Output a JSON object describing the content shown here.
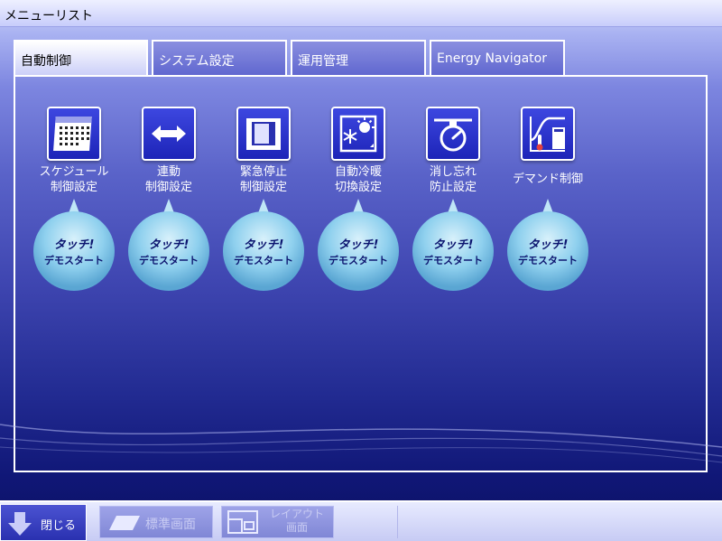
{
  "window": {
    "title": "メニューリスト"
  },
  "tabs": [
    {
      "label": "自動制御",
      "active": true
    },
    {
      "label": "システム設定",
      "active": false
    },
    {
      "label": "運用管理",
      "active": false
    },
    {
      "label": "Energy Navigator",
      "active": false
    }
  ],
  "demo": {
    "title": "タッチ!",
    "subtitle": "デモスタート"
  },
  "items": [
    {
      "line1": "スケジュール",
      "line2": "制御設定",
      "icon": "calendar-icon"
    },
    {
      "line1": "連動",
      "line2": "制御設定",
      "icon": "double-arrow-icon"
    },
    {
      "line1": "緊急停止",
      "line2": "制御設定",
      "icon": "emergency-stop-icon"
    },
    {
      "line1": "自動冷暖",
      "line2": "切換設定",
      "icon": "heat-cool-switch-icon"
    },
    {
      "line1": "消し忘れ",
      "line2": "防止設定",
      "icon": "stopwatch-icon"
    },
    {
      "line1": "デマンド制御",
      "line2": "",
      "icon": "demand-control-icon"
    }
  ],
  "bottom": {
    "close_label": "閉じる",
    "standard_label": "標準画面",
    "layout_line1": "レイアウト",
    "layout_line2": "画面"
  },
  "colors": {
    "accent": "#2a31b0",
    "bubble": "#8fd0ee",
    "bubble_text": "#0d1670"
  }
}
